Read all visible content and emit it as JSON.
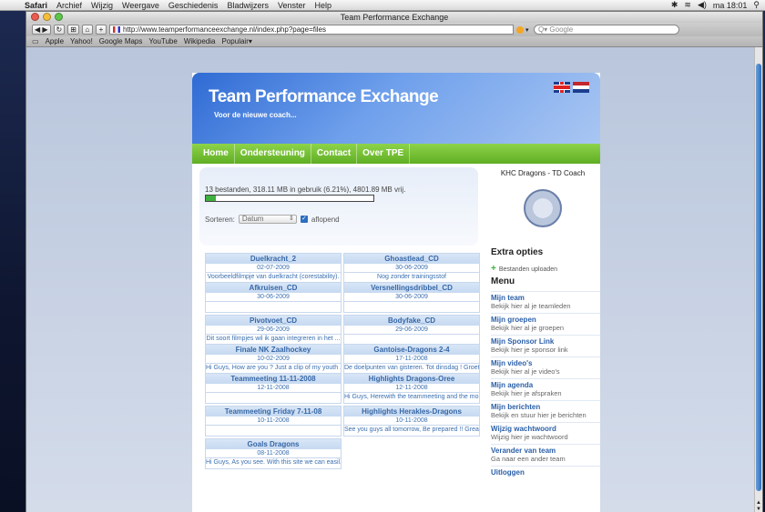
{
  "menubar": {
    "app": "Safari",
    "items": [
      "Archief",
      "Wijzig",
      "Weergave",
      "Geschiedenis",
      "Bladwijzers",
      "Venster",
      "Help"
    ],
    "clock": "ma 18:01"
  },
  "browser": {
    "window_title": "Team Performance Exchange",
    "url": "http://www.teamperformanceexchange.nl/index.php?page=files",
    "search_placeholder": "Q▾ Google",
    "bookmarks": [
      "Apple",
      "Yahoo!",
      "Google Maps",
      "YouTube",
      "Wikipedia",
      "Populair▾"
    ]
  },
  "site": {
    "title": "Team Performance Exchange",
    "subtitle": "Voor de nieuwe coach...",
    "nav": [
      "Home",
      "Ondersteuning",
      "Contact",
      "Over TPE"
    ]
  },
  "usage": {
    "text": "13 bestanden, 318.11 MB in gebruik (6.21%), 4801.89 MB vrij.",
    "percent": 6.21,
    "sort_label": "Sorteren:",
    "sort_value": "Datum",
    "desc_label": "aflopend"
  },
  "files": [
    {
      "title": "Duelkracht_2",
      "date": "02-07-2009",
      "desc": "Voorbeeldfilmpje van duelkracht (corestability)."
    },
    {
      "title": "Ghoastlead_CD",
      "date": "30-06-2009",
      "desc": "Nog zonder trainingsstof"
    },
    {
      "title": "Afkruisen_CD",
      "date": "30-06-2009",
      "desc": ""
    },
    {
      "title": "Versnellingsdribbel_CD",
      "date": "30-06-2009",
      "desc": ""
    },
    {
      "title": "Pivotvoet_CD",
      "date": "29-06-2009",
      "desc": "Dit soort filmpjes wil ik gaan integreren in het ..."
    },
    {
      "title": "Bodyfake_CD",
      "date": "29-06-2009",
      "desc": ""
    },
    {
      "title": "Finale NK Zaalhockey",
      "date": "10-02-2009",
      "desc": "Hi Guys, How are you ? Just a clip of my youth ..."
    },
    {
      "title": "Gantoise-Dragons 2-4",
      "date": "17-11-2008",
      "desc": "De doelpunten van gisteren. Tot dinsdag ! Groete..."
    },
    {
      "title": "Teammeeting 11-11-2008",
      "date": "12-11-2008",
      "desc": ""
    },
    {
      "title": "Highlights Dragons-Oree",
      "date": "12-11-2008",
      "desc": "Hi Guys, Herewith the teammeeting and the moment..."
    },
    {
      "title": "Teammeeting Friday 7-11-08",
      "date": "10-11-2008",
      "desc": ""
    },
    {
      "title": "Highlights Herakles-Dragons",
      "date": "10-11-2008",
      "desc": "See you guys all tomorrow, Be prepared !! Great..."
    },
    {
      "title": "Goals Dragons",
      "date": "08-11-2008",
      "desc": "Hi Guys, As you see. With this site we can easil..."
    }
  ],
  "sidebar": {
    "coach_label": "KHC Dragons - TD Coach",
    "extra_heading": "Extra opties",
    "upload_label": "Bestanden uploaden",
    "menu_heading": "Menu",
    "menu": [
      {
        "title": "Mijn team",
        "desc": "Bekijk hier al je teamleden"
      },
      {
        "title": "Mijn groepen",
        "desc": "Bekijk hier al je groepen"
      },
      {
        "title": "Mijn Sponsor Link",
        "desc": "Bekijk hier je sponsor link"
      },
      {
        "title": "Mijn video's",
        "desc": "Bekijk hier al je video's"
      },
      {
        "title": "Mijn agenda",
        "desc": "Bekijk hier je afspraken"
      },
      {
        "title": "Mijn berichten",
        "desc": "Bekijk en stuur hier je berichten"
      },
      {
        "title": "Wijzig wachtwoord",
        "desc": "Wijzig hier je wachtwoord"
      },
      {
        "title": "Verander van team",
        "desc": "Ga naar een ander team"
      },
      {
        "title": "Uitloggen",
        "desc": ""
      }
    ]
  }
}
